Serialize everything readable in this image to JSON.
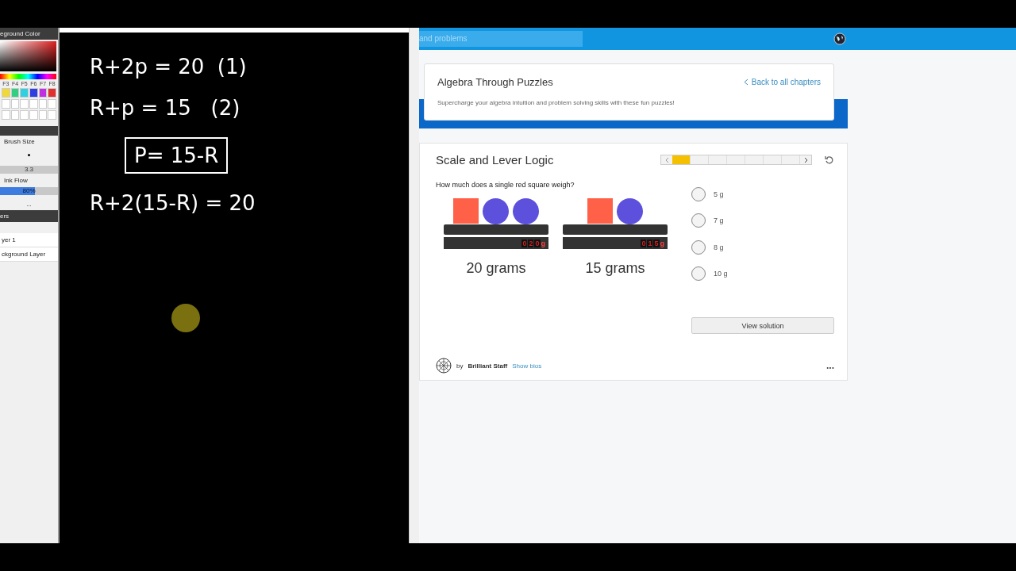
{
  "paint_panel": {
    "color_header": "eground Color",
    "palette": [
      {
        "label": "F3",
        "color": "#f0d838"
      },
      {
        "label": "F4",
        "color": "#30d080"
      },
      {
        "label": "F5",
        "color": "#30d0e0"
      },
      {
        "label": "F6",
        "color": "#3040e0"
      },
      {
        "label": "F7",
        "color": "#c030e0"
      },
      {
        "label": "F8",
        "color": "#e03030"
      }
    ],
    "brush_size_label": "Brush Size",
    "brush_size_value": "3.3",
    "ink_flow_label": "Ink Flow",
    "ink_flow": {
      "reading": "80%",
      "level": 0.6
    },
    "more": "...",
    "layers_header": "ers",
    "layers": [
      {
        "name": "yer 1",
        "selected": false
      },
      {
        "name": "ckground Layer",
        "selected": false
      }
    ]
  },
  "canvas": {
    "lines": [
      {
        "kind": "plain",
        "text": "R+2p = 20  (1)"
      },
      {
        "kind": "plain",
        "text": "R+p = 15   (2)"
      },
      {
        "kind": "boxed",
        "text": "P= 15-R"
      },
      {
        "kind": "plain",
        "text": "R+2(15-R) = 20"
      }
    ]
  },
  "browser": {
    "search": {
      "value": "and problems"
    },
    "chapter": {
      "title": "Algebra Through Puzzles",
      "back_link": "Back to all chapters",
      "description": "Supercharge your algebra intuition and problem solving skills with these fun puzzles!"
    },
    "puzzle": {
      "title": "Scale and Lever Logic",
      "steps": [
        {
          "selected": true
        },
        {
          "selected": false
        },
        {
          "selected": false
        },
        {
          "selected": false
        },
        {
          "selected": false
        },
        {
          "selected": false
        },
        {
          "selected": false
        }
      ],
      "question": "How much does a single red square weigh?",
      "scales": [
        {
          "items": [
            {
              "kind": "square"
            },
            {
              "kind": "circle"
            },
            {
              "kind": "circle"
            }
          ],
          "digits": [
            "0",
            "2",
            "0"
          ],
          "unit": "g",
          "caption": "20 grams"
        },
        {
          "items": [
            {
              "kind": "square"
            },
            {
              "kind": "circle"
            }
          ],
          "digits": [
            "0",
            "1",
            "5"
          ],
          "unit": "g",
          "caption": "15 grams"
        }
      ],
      "options": [
        {
          "label": "5 g",
          "selected": false
        },
        {
          "label": "7 g",
          "selected": false
        },
        {
          "label": "8 g",
          "selected": false
        },
        {
          "label": "10 g",
          "selected": false
        }
      ],
      "solution_button": "View solution",
      "author_prefix": "by",
      "author": "Brilliant Staff",
      "bios_link": "Show bios",
      "more": "..."
    }
  }
}
